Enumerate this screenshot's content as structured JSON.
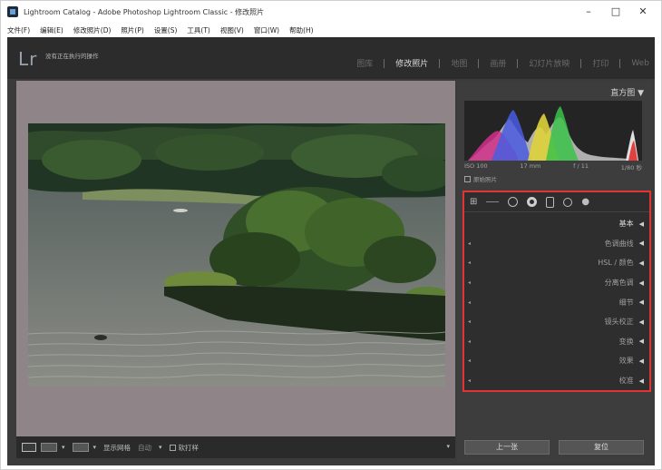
{
  "window": {
    "title": "Lightroom Catalog - Adobe Photoshop Lightroom Classic - 修改照片",
    "minimize": "–",
    "maximize": "□",
    "close": "✕"
  },
  "menu": [
    "文件(F)",
    "编辑(E)",
    "修改照片(D)",
    "照片(P)",
    "设置(S)",
    "工具(T)",
    "视图(V)",
    "窗口(W)",
    "帮助(H)"
  ],
  "identity": {
    "logo": "Lr",
    "status": "没有正在执行的操作"
  },
  "modules": [
    {
      "label": "图库",
      "active": false
    },
    {
      "label": "修改照片",
      "active": true
    },
    {
      "label": "地图",
      "active": false
    },
    {
      "label": "画册",
      "active": false
    },
    {
      "label": "幻灯片放映",
      "active": false
    },
    {
      "label": "打印",
      "active": false
    },
    {
      "label": "Web",
      "active": false
    }
  ],
  "histogram": {
    "title": "直方图 ▼",
    "iso": "ISO 100",
    "focal": "17 mm",
    "aperture": "f / 11",
    "shutter": "1/80 秒",
    "original_label": "原始照片"
  },
  "panels": {
    "sections": [
      {
        "label": "基本",
        "active": true
      },
      {
        "label": "色调曲线",
        "active": false
      },
      {
        "label": "HSL / 颜色",
        "active": false
      },
      {
        "label": "分离色调",
        "active": false
      },
      {
        "label": "细节",
        "active": false
      },
      {
        "label": "镜头校正",
        "active": false
      },
      {
        "label": "变换",
        "active": false
      },
      {
        "label": "效果",
        "active": false
      },
      {
        "label": "校准",
        "active": false
      }
    ]
  },
  "toolbar": {
    "flag_label": "显示网格",
    "auto_label": "自动",
    "softproof_label": "软打样",
    "view_compare": "XY",
    "view_yy": "YY"
  },
  "buttons": {
    "previous": "上一张",
    "reset": "复位"
  },
  "colors": {
    "accent_red": "#e43333",
    "panel_bg": "#3d3d3d"
  }
}
